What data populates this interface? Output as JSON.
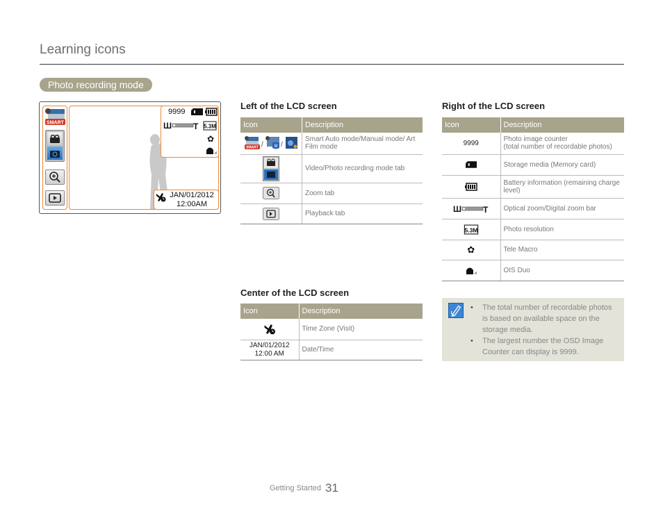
{
  "page": {
    "title": "Learning icons",
    "section": "Photo recording mode",
    "footer_section": "Getting Started",
    "page_number": "31"
  },
  "lcd": {
    "counter": "9999",
    "date": "JAN/01/2012",
    "time": "12:00AM",
    "smart_label": "SMART",
    "zoom_w": "W",
    "zoom_t": "T"
  },
  "tables": {
    "header": {
      "icon": "Icon",
      "description": "Description"
    },
    "left": {
      "heading": "Left of the LCD screen",
      "rows": [
        {
          "icon": "smart-manual-artfilm-icons",
          "description": "Smart Auto mode/Manual mode/ Art Film mode"
        },
        {
          "icon": "video-photo-tab-icon",
          "description": "Video/Photo recording mode tab"
        },
        {
          "icon": "zoom-tab-icon",
          "description": "Zoom tab"
        },
        {
          "icon": "playback-tab-icon",
          "description": "Playback tab"
        }
      ]
    },
    "center": {
      "heading": "Center of the LCD screen",
      "rows": [
        {
          "icon": "time-zone-visit-icon",
          "description": "Time Zone (Visit)"
        },
        {
          "icon_text_1": "JAN/01/2012",
          "icon_text_2": "12:00 AM",
          "description": "Date/Time"
        }
      ]
    },
    "right": {
      "heading": "Right of the LCD screen",
      "rows": [
        {
          "icon_text": "9999",
          "description_1": "Photo image counter",
          "description_2": "(total number of recordable photos)"
        },
        {
          "icon": "memory-card-icon",
          "description": "Storage media (Memory card)"
        },
        {
          "icon": "battery-icon",
          "description": "Battery information (remaining charge level)"
        },
        {
          "icon": "zoom-bar-icon",
          "description": "Optical zoom/Digital zoom bar"
        },
        {
          "icon": "photo-resolution-icon",
          "icon_text": "5.3M",
          "description": "Photo resolution"
        },
        {
          "icon": "tele-macro-icon",
          "description": "Tele Macro"
        },
        {
          "icon": "ois-duo-icon",
          "description": "OIS Duo"
        }
      ]
    }
  },
  "note": {
    "items": [
      "The total number of recordable photos is based on available space on the storage media.",
      "The largest number the OSD Image Counter can display is 9999."
    ]
  },
  "colors": {
    "accent": "#a8a48c",
    "lcd_frame": "#e88a3a",
    "note_bg": "#e3e3d9",
    "tab_blue": "#2670c2"
  }
}
